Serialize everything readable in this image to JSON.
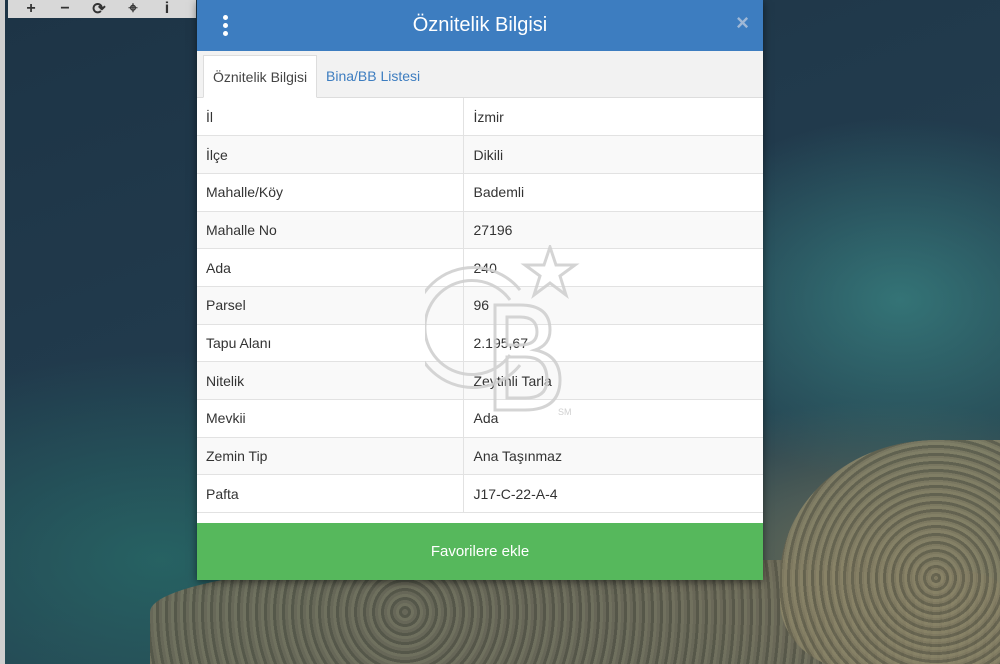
{
  "toolbar": {
    "items": [
      {
        "icon": "plus-icon",
        "glyph": "+"
      },
      {
        "icon": "minus-icon",
        "glyph": "−"
      },
      {
        "icon": "refresh-icon",
        "glyph": "⟳"
      },
      {
        "icon": "locate-icon",
        "glyph": "⌖"
      },
      {
        "icon": "info-icon",
        "glyph": "i"
      }
    ]
  },
  "modal": {
    "title": "Öznitelik Bilgisi",
    "close_glyph": "×",
    "tabs": [
      {
        "label": "Öznitelik Bilgisi",
        "active": true
      },
      {
        "label": "Bina/BB Listesi",
        "active": false
      }
    ],
    "rows": [
      {
        "key": "İl",
        "value": "İzmir"
      },
      {
        "key": "İlçe",
        "value": "Dikili"
      },
      {
        "key": "Mahalle/Köy",
        "value": "Bademli"
      },
      {
        "key": "Mahalle No",
        "value": "27196"
      },
      {
        "key": "Ada",
        "value": "240"
      },
      {
        "key": "Parsel",
        "value": "96"
      },
      {
        "key": "Tapu Alanı",
        "value": "2.195,67"
      },
      {
        "key": "Nitelik",
        "value": "Zeytinli Tarla"
      },
      {
        "key": "Mevkii",
        "value": "Ada"
      },
      {
        "key": "Zemin Tip",
        "value": "Ana Taşınmaz"
      },
      {
        "key": "Pafta",
        "value": "J17-C-22-A-4"
      }
    ],
    "favorite_label": "Favorilere ekle"
  },
  "colors": {
    "header": "#3d7dc0",
    "favorite": "#56b85c",
    "tab_link": "#3d7dc0"
  }
}
